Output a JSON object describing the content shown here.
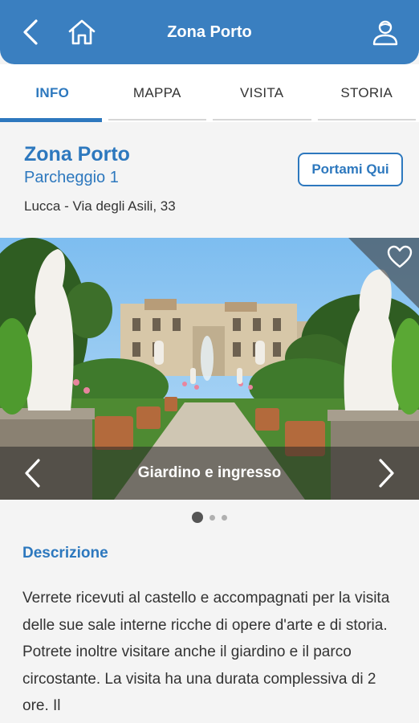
{
  "header": {
    "title": "Zona Porto",
    "back_icon": "chevron-left-icon",
    "home_icon": "home-icon",
    "user_icon": "user-icon",
    "color": "#3a7fc0"
  },
  "tabs": [
    {
      "label": "INFO",
      "active": true
    },
    {
      "label": "MAPPA",
      "active": false
    },
    {
      "label": "VISITA",
      "active": false
    },
    {
      "label": "STORIA",
      "active": false
    }
  ],
  "poi": {
    "title": "Zona Porto",
    "subtitle": "Parcheggio 1",
    "address": "Lucca - Via degli Asili, 33",
    "go_button_label": "Portami Qui"
  },
  "gallery": {
    "caption": "Giardino e ingresso",
    "favorite_icon": "heart-outline-icon",
    "prev_icon": "chevron-left-icon",
    "next_icon": "chevron-right-icon",
    "dots": [
      {
        "active": true
      },
      {
        "active": false
      },
      {
        "active": false
      }
    ]
  },
  "description": {
    "heading": "Descrizione",
    "text": "Verrete ricevuti al castello e accompagnati per la visita delle sue sale interne ricche di opere d'arte e di storia. Potrete inoltre visitare anche il giardino e il parco circostante. La visita ha una durata complessiva di 2 ore. Il"
  },
  "colors": {
    "accent": "#2d78be",
    "background": "#f4f4f4"
  }
}
